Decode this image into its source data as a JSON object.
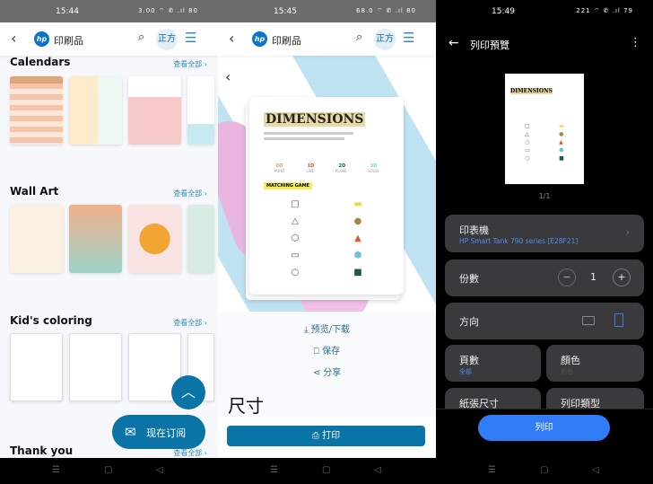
{
  "panel1": {
    "status": {
      "time": "15:44",
      "icons": "3.00 ⌔ ✆ .ıl 80"
    },
    "header": {
      "back": "‹",
      "logo": "hp",
      "title": "印刷品",
      "search_icon": "⌕",
      "zoom_label": "正方",
      "menu_icon": "☰"
    },
    "sections": [
      {
        "title": "Calendars",
        "see_all": "查看全部 ›"
      },
      {
        "title": "Wall Art",
        "see_all": "查看全部 ›"
      },
      {
        "title": "Kid's coloring",
        "see_all": "查看全部 ›"
      },
      {
        "title": "Thank you",
        "see_all": "查看全部 ›"
      }
    ],
    "fab_icon": "︿",
    "subscribe": {
      "icon": "✉",
      "label": "现在订阅"
    }
  },
  "panel2": {
    "status": {
      "time": "15:45",
      "icons": "68.0 ⌔ ✆ .ıl 80"
    },
    "header": {
      "back": "‹",
      "logo": "hp",
      "title": "印刷品",
      "search_icon": "⌕",
      "zoom_label": "正方",
      "menu_icon": "☰"
    },
    "carousel_back": "‹",
    "doc": {
      "title": "DIMENSIONS",
      "labels": [
        "0D",
        "1D",
        "2D",
        "3D"
      ],
      "sublabels": [
        "POINT",
        "LINE",
        "PLANE",
        "SOLID"
      ],
      "matching": "MATCHING GAME"
    },
    "actions": [
      {
        "icon": "⤓",
        "label": "预览/下载"
      },
      {
        "icon": "⎕",
        "label": "保存"
      },
      {
        "icon": "⋖",
        "label": "分享"
      }
    ],
    "size_heading": "尺寸",
    "print_button": {
      "icon": "⎙",
      "label": "打印"
    }
  },
  "panel3": {
    "status": {
      "time": "15:49",
      "icons": "221 ⌔ ✆ .ıl 79"
    },
    "header": {
      "back": "←",
      "title": "列印預覽",
      "more": "⋮"
    },
    "page_count": "1/1",
    "printer": {
      "label": "印表機",
      "value": "HP Smart Tank 790 series [E28F21]"
    },
    "copies": {
      "label": "份數",
      "value": "1",
      "minus": "−",
      "plus": "+"
    },
    "orientation": {
      "label": "方向",
      "selected": "portrait"
    },
    "pages": {
      "label": "頁數",
      "value": "全部"
    },
    "color": {
      "label": "顏色",
      "value": "彩色"
    },
    "paper_size": {
      "label": "紙張尺寸"
    },
    "print_type": {
      "label": "列印類型"
    },
    "print_button": "列印"
  },
  "colors": {
    "accent": "#0a74a6",
    "dark_card": "#3a3a3c",
    "blue_button": "#2f7cf6"
  },
  "nav": {
    "menu": "☰",
    "home": "▢",
    "back": "◁"
  }
}
